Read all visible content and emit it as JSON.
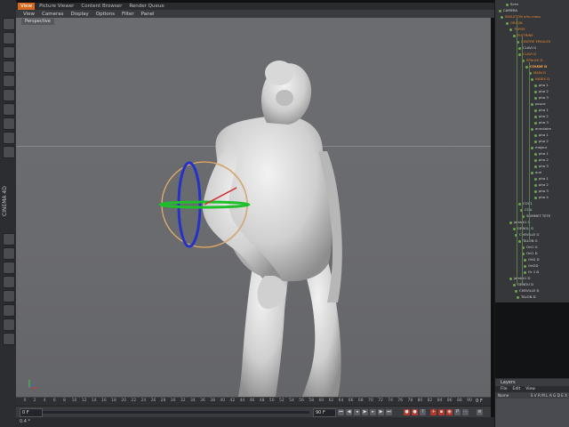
{
  "top_tabs": [
    "View",
    "Picture Viewer",
    "Content Browser",
    "Render Queue"
  ],
  "menu": [
    "View",
    "Cameras",
    "Display",
    "Options",
    "Filter",
    "Panel"
  ],
  "viewport": {
    "label": "Perspective"
  },
  "side_label": "CINEMA 4D",
  "timeline": {
    "ticks": [
      "0",
      "2",
      "4",
      "6",
      "8",
      "10",
      "12",
      "14",
      "16",
      "18",
      "20",
      "22",
      "24",
      "26",
      "28",
      "30",
      "32",
      "34",
      "36",
      "38",
      "40",
      "42",
      "44",
      "46",
      "48",
      "50",
      "52",
      "54",
      "56",
      "58",
      "60",
      "62",
      "64",
      "66",
      "68",
      "70",
      "72",
      "74",
      "76",
      "78",
      "80",
      "82",
      "84",
      "86",
      "88",
      "90"
    ],
    "current_frame": "0 F",
    "start_field": "0 F",
    "end_field": "90 F"
  },
  "status": "0.4 *",
  "objects": [
    {
      "label": "Scen",
      "style": "normal"
    },
    {
      "label": "CAMERA",
      "style": "normal"
    },
    {
      "label": "SKELETON afro-mass",
      "style": "orange"
    },
    {
      "label": "ORIGIN",
      "style": "orange"
    },
    {
      "label": "TORSE",
      "style": "orange"
    },
    {
      "label": "POITRINE",
      "style": "orange"
    },
    {
      "label": "CENTRE EPAULES",
      "style": "orange"
    },
    {
      "label": "CLAVI G",
      "style": "normal"
    },
    {
      "label": "CLAVI D",
      "style": "orange"
    },
    {
      "label": "EPAULE D",
      "style": "orange"
    },
    {
      "label": "COUDE D",
      "style": "sel"
    },
    {
      "label": "MAIN D",
      "style": "orange"
    },
    {
      "label": "INDEX D",
      "style": "orange"
    },
    {
      "label": "pha 1",
      "style": "normal"
    },
    {
      "label": "pha 2",
      "style": "normal"
    },
    {
      "label": "pha 3",
      "style": "normal"
    },
    {
      "label": "pouce",
      "style": "normal"
    },
    {
      "label": "pha 1",
      "style": "normal"
    },
    {
      "label": "pha 2",
      "style": "normal"
    },
    {
      "label": "pha 3",
      "style": "normal"
    },
    {
      "label": "annulaire",
      "style": "normal"
    },
    {
      "label": "pha 1",
      "style": "normal"
    },
    {
      "label": "pha 2",
      "style": "normal"
    },
    {
      "label": "majeur",
      "style": "normal"
    },
    {
      "label": "pha 1",
      "style": "normal"
    },
    {
      "label": "pha 2",
      "style": "normal"
    },
    {
      "label": "pha 3",
      "style": "normal"
    },
    {
      "label": "auri",
      "style": "normal"
    },
    {
      "label": "pha 1",
      "style": "normal"
    },
    {
      "label": "pha 2",
      "style": "normal"
    },
    {
      "label": "pha 3",
      "style": "normal"
    },
    {
      "label": "pha 4",
      "style": "normal"
    },
    {
      "label": "COU1",
      "style": "normal"
    },
    {
      "label": "COU",
      "style": "normal"
    },
    {
      "label": "SOMMET TETE",
      "style": "normal"
    },
    {
      "label": "jambe1 G",
      "style": "normal"
    },
    {
      "label": "GENOU G",
      "style": "normal"
    },
    {
      "label": "CHEVILLE G",
      "style": "normal"
    },
    {
      "label": "TALON G",
      "style": "normal"
    },
    {
      "label": "Ort1 G",
      "style": "normal"
    },
    {
      "label": "Ort1 D",
      "style": "normal"
    },
    {
      "label": "Ort2 D",
      "style": "normal"
    },
    {
      "label": "Ort2D",
      "style": "normal"
    },
    {
      "label": "Or 1 D",
      "style": "normal"
    },
    {
      "label": "jambe1 D",
      "style": "normal"
    },
    {
      "label": "GENOU D",
      "style": "normal"
    },
    {
      "label": "CHEVILLE D",
      "style": "normal"
    },
    {
      "label": "TALON D",
      "style": "normal"
    }
  ],
  "layers": {
    "title": "Layers",
    "menu": [
      "File",
      "Edit",
      "View"
    ],
    "col_name": "Name",
    "col_flags": "S V R M L A G D E X"
  }
}
